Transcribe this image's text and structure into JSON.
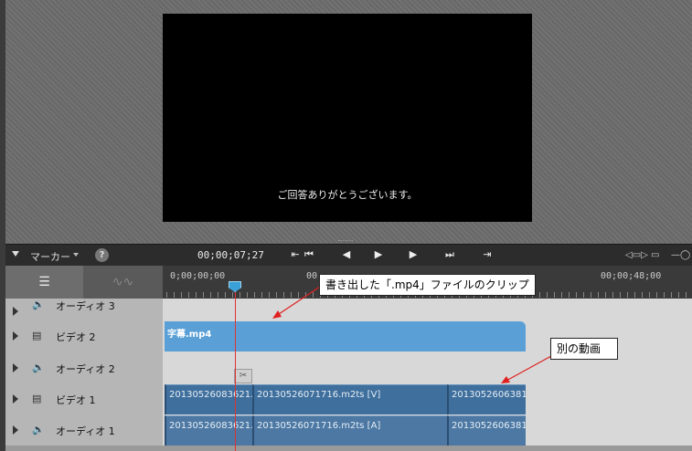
{
  "preview": {
    "subtitle": "ご回答ありがとうございます。"
  },
  "transport": {
    "marker_label": "マーカー",
    "help_label": "?",
    "timecode": "00;00;07;27"
  },
  "ruler": {
    "start": "0;00;00;00",
    "mid": "00",
    "end": "00;00;48;00"
  },
  "tracks": [
    {
      "label": "オーディオ 3",
      "type": "audio"
    },
    {
      "label": "ビデオ 2",
      "type": "video",
      "clips": [
        "字幕.mp4"
      ]
    },
    {
      "label": "オーディオ 2",
      "type": "audio"
    },
    {
      "label": "ビデオ 1",
      "type": "video",
      "clips": [
        "20130526083621.",
        "20130526071716.m2ts [V]",
        "2013052606381"
      ]
    },
    {
      "label": "オーディオ 1",
      "type": "audio",
      "clips": [
        "20130526083621.",
        "20130526071716.m2ts [A]",
        "2013052606381"
      ]
    }
  ],
  "annotations": {
    "clip_callout": "書き出した「.mp4」ファイルのクリップ",
    "other_video_callout": "別の動画"
  },
  "icons": {
    "expand": "triangle-right-icon",
    "audio": "speaker-icon",
    "video": "film-icon",
    "scissors": "scissors-icon"
  },
  "colors": {
    "clip_v2": "#5aa0d6",
    "clip_v1": "#3f6f9d",
    "playhead": "#3aa0d8",
    "arrow": "#e02020"
  }
}
